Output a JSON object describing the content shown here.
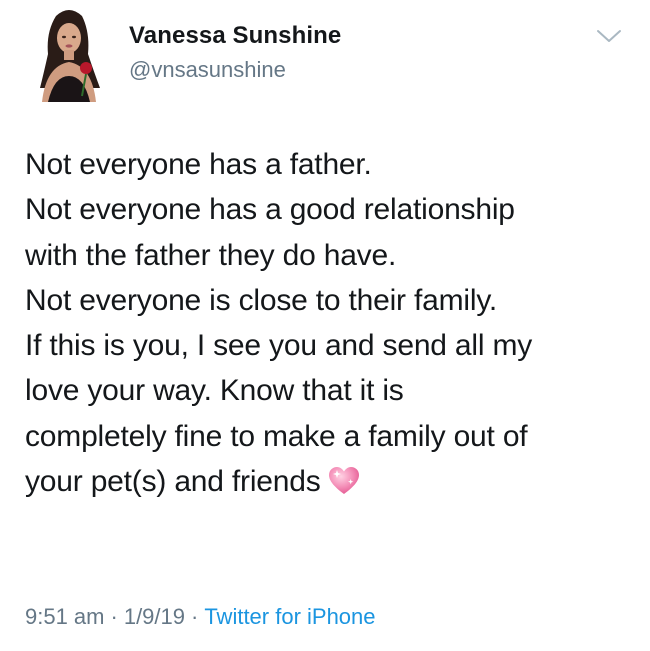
{
  "tweet": {
    "author": {
      "display_name": "Vanessa Sunshine",
      "handle": "@vnsasunshine",
      "avatar_icon": "profile-photo-avatar"
    },
    "menu_icon": "chevron-down-icon",
    "body_lines": [
      "Not everyone has a father.",
      "Not everyone has a good relationship",
      "with the father they do have.",
      "Not everyone is close to their family.",
      "If this is you, I see you and send all my",
      "love your way. Know that it is",
      "completely fine to make a family out of",
      "your pet(s) and friends"
    ],
    "emoji": "sparkling-heart-icon",
    "meta": {
      "time": "9:51 am",
      "separator": "·",
      "date": "1/9/19",
      "source": "Twitter for iPhone"
    },
    "colors": {
      "text": "#14171a",
      "secondary": "#657786",
      "link": "#1b95e0",
      "heart": "#f48fb8"
    }
  }
}
